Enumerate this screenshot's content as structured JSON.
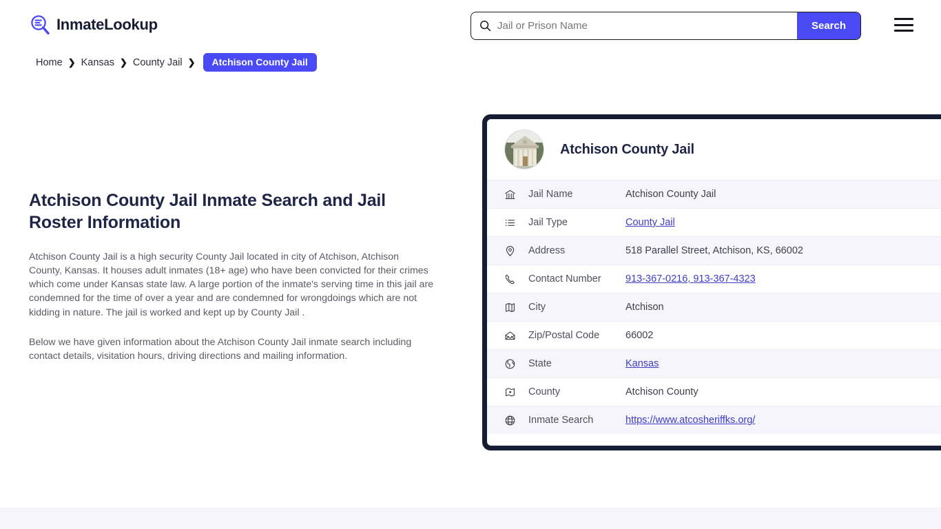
{
  "header": {
    "logo_text": "InmateLookup",
    "logo_icon": "magnifier-list-icon",
    "search": {
      "placeholder": "Jail or Prison Name",
      "value": "",
      "button_label": "Search",
      "icon": "search-icon"
    },
    "menu_icon": "hamburger-menu-icon"
  },
  "breadcrumb": {
    "items": [
      {
        "label": "Home",
        "active": false
      },
      {
        "label": "Kansas",
        "active": false
      },
      {
        "label": "County Jail",
        "active": false
      },
      {
        "label": "Atchison County Jail",
        "active": true
      }
    ],
    "separator": "❯"
  },
  "main": {
    "title": "Atchison County Jail Inmate Search and Jail Roster Information",
    "paragraph_1": "Atchison County Jail is a high security County Jail located in city of Atchison, Atchison County, Kansas. It houses adult inmates (18+ age) who have been convicted for their crimes which come under Kansas state law. A large portion of the inmate's serving time in this jail are condemned for the time of over a year and are condemned for wrongdoings which are not kidding in nature. The jail is worked and kept up by County Jail .",
    "paragraph_2": "Below we have given information about the Atchison County Jail inmate search including contact details, visitation hours, driving directions and mailing information."
  },
  "jail_card": {
    "title": "Atchison County Jail",
    "avatar_icon": "courthouse-photo",
    "rows": [
      {
        "icon": "bank-icon",
        "label": "Jail Name",
        "value": "Atchison County Jail",
        "link": false
      },
      {
        "icon": "list-icon",
        "label": "Jail Type",
        "value": "County Jail",
        "link": true
      },
      {
        "icon": "map-pin-icon",
        "label": "Address",
        "value": "518 Parallel Street, Atchison, KS, 66002",
        "link": false
      },
      {
        "icon": "phone-icon",
        "label": "Contact Number",
        "value": "913-367-0216, 913-367-4323",
        "link": true
      },
      {
        "icon": "map-icon",
        "label": "City",
        "value": "Atchison",
        "link": false
      },
      {
        "icon": "envelope-icon",
        "label": "Zip/Postal Code",
        "value": "66002",
        "link": false
      },
      {
        "icon": "globe-americas-icon",
        "label": "State",
        "value": "Kansas",
        "link": true
      },
      {
        "icon": "map-marker-icon",
        "label": "County",
        "value": "Atchison County",
        "link": false
      },
      {
        "icon": "globe-icon",
        "label": "Inmate Search",
        "value": "https://www.atcosheriffks.org/",
        "link": true
      }
    ]
  },
  "colors": {
    "accent_blue": "#4A4AF4",
    "dark_navy": "#171c35",
    "row_alt": "#F5F5FB",
    "link": "#3d3dc7",
    "title": "#1F2544"
  }
}
